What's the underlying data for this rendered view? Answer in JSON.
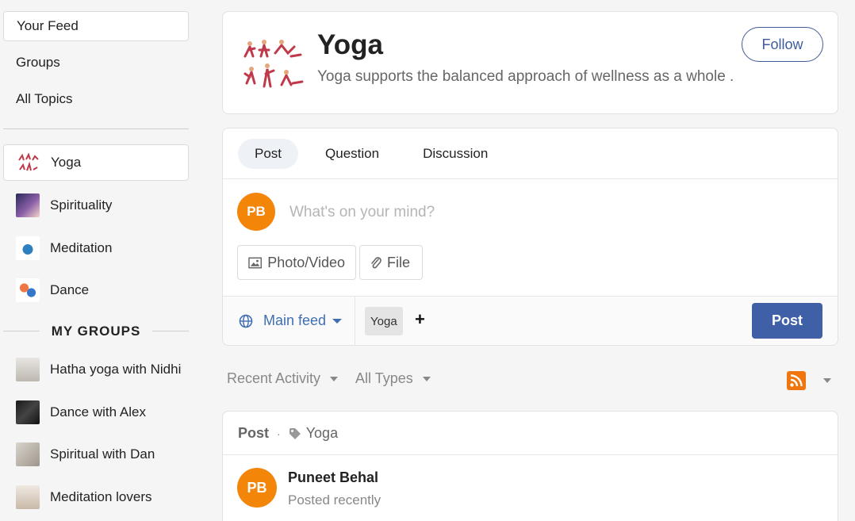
{
  "sidebar": {
    "nav": [
      "Your Feed",
      "Groups",
      "All Topics"
    ],
    "topics": [
      {
        "label": "Yoga",
        "icon": "yoga-thumbnail"
      },
      {
        "label": "Spirituality",
        "icon": "spirituality-thumbnail"
      },
      {
        "label": "Meditation",
        "icon": "meditation-thumbnail"
      },
      {
        "label": "Dance",
        "icon": "dance-thumbnail"
      }
    ],
    "my_groups_heading": "MY GROUPS",
    "groups": [
      {
        "label": "Hatha yoga with Nidhi",
        "icon": "hatha-yoga-thumbnail"
      },
      {
        "label": "Dance with Alex",
        "icon": "dance-alex-thumbnail"
      },
      {
        "label": "Spiritual with Dan",
        "icon": "spiritual-dan-thumbnail"
      },
      {
        "label": "Meditation lovers",
        "icon": "meditation-lovers-thumbnail"
      }
    ]
  },
  "topic_header": {
    "title": "Yoga",
    "description": "Yoga supports the balanced approach of wellness as a whole .",
    "follow_label": "Follow"
  },
  "composer": {
    "tabs": [
      "Post",
      "Question",
      "Discussion"
    ],
    "avatar_initials": "PB",
    "placeholder": "What's on your mind?",
    "photo_video_label": "Photo/Video",
    "file_label": "File",
    "feed_selector": "Main feed",
    "tag": "Yoga",
    "add_tag": "+",
    "post_label": "Post"
  },
  "filters": {
    "activity": "Recent Activity",
    "types": "All Types"
  },
  "post": {
    "kind": "Post",
    "separator": "·",
    "topic": "Yoga",
    "avatar_initials": "PB",
    "author": "Puneet Behal",
    "status": "Posted recently"
  },
  "colors": {
    "accent": "#3f5fa6",
    "avatar": "#f38508",
    "rss": "#f0750f"
  }
}
